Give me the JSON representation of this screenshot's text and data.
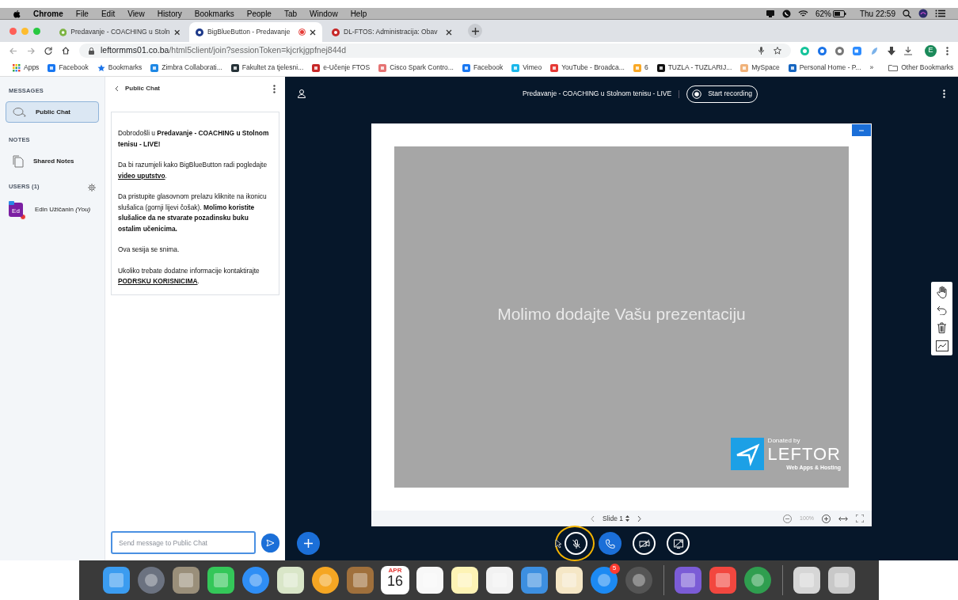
{
  "menubar": {
    "app": "Chrome",
    "menus": [
      "File",
      "Edit",
      "View",
      "History",
      "Bookmarks",
      "People",
      "Tab",
      "Window",
      "Help"
    ],
    "battery": "62%",
    "clock": "Thu 22:59"
  },
  "tabs": [
    {
      "title": "Predavanje - COACHING u Stoln",
      "selected": false,
      "recording": false,
      "color": "#7cb342"
    },
    {
      "title": "BigBlueButton - Predavanje",
      "selected": true,
      "recording": true,
      "color": "#1e3a8a"
    },
    {
      "title": "DL-FTOS: Administracija: Obav",
      "selected": false,
      "recording": false,
      "color": "#c62828"
    }
  ],
  "address": {
    "host": "leftormms01.co.ba",
    "path": "/html5client/join?sessionToken=kjcrkjgpfnej844d"
  },
  "profile": "E",
  "bookmarks": [
    {
      "label": "Apps",
      "kind": "grid"
    },
    {
      "label": "Facebook",
      "kind": "site",
      "color": "#1877f2"
    },
    {
      "label": "Bookmarks",
      "kind": "star",
      "color": "#1a73e8"
    },
    {
      "label": "Zimbra Collaborati...",
      "kind": "site",
      "color": "#1e88e5"
    },
    {
      "label": "Fakultet za tjelesni...",
      "kind": "site",
      "color": "#263238"
    },
    {
      "label": "e-Učenje FTOS",
      "kind": "site",
      "color": "#c62828"
    },
    {
      "label": "Cisco Spark Contro...",
      "kind": "site",
      "color": "#e57373"
    },
    {
      "label": "Facebook",
      "kind": "site",
      "color": "#1877f2"
    },
    {
      "label": "Vimeo",
      "kind": "site",
      "color": "#1ab7ea"
    },
    {
      "label": "YouTube - Broadca...",
      "kind": "site",
      "color": "#e53935"
    },
    {
      "label": "6",
      "kind": "site",
      "color": "#f9a825"
    },
    {
      "label": "TUZLA - TUZLARIJ...",
      "kind": "site",
      "color": "#111111"
    },
    {
      "label": "MySpace",
      "kind": "site",
      "color": "#f0b27a"
    },
    {
      "label": "Personal Home - P...",
      "kind": "site",
      "color": "#1565c0"
    }
  ],
  "bookmarks_more": "»",
  "other_bookmarks": "Other Bookmarks",
  "sidebar": {
    "messages_heading": "MESSAGES",
    "public_chat": {
      "label": "Public Chat",
      "selected": true
    },
    "notes_heading": "NOTES",
    "shared_notes": {
      "label": "Shared Notes",
      "selected": false
    },
    "users_heading": "USERS (1)",
    "users": [
      {
        "initials": "Ed",
        "name": "Edin Užičanin",
        "you": "(You)",
        "color": "#7b1fa2"
      }
    ]
  },
  "chat": {
    "title": "Public Chat",
    "welcome": [
      {
        "parts": [
          {
            "text": "Dobrodošli u **Predavanje - COACHING u Stolnom tenisu - LIVE!**",
            "link": false
          }
        ]
      },
      {
        "parts": [
          {
            "text": "Da bi razumjeli kako BigBlueButton radi pogledajte ",
            "link": false
          },
          {
            "text": "video uputstvo",
            "link": true
          },
          {
            "text": ".",
            "link": false
          }
        ]
      },
      {
        "parts": [
          {
            "text": "Da pristupite glasovnom prelazu kliknite na ikonicu slušalica (gornji lijevi čošak). **Molimo koristite slušalice da ne stvarate pozadinsku buku ostalim učenicima.**",
            "link": false
          }
        ]
      },
      {
        "parts": [
          {
            "text": "Ova sesija se snima.",
            "link": false
          }
        ]
      },
      {
        "parts": [
          {
            "text": "Ukoliko trebate dodatne informacije kontaktirajte ",
            "link": false
          },
          {
            "text": "PODRSKU KORISNICIMA",
            "link": true
          },
          {
            "text": ".",
            "link": false
          }
        ]
      }
    ],
    "placeholder": "Send message to Public Chat"
  },
  "meeting": {
    "title": "Predavanje - COACHING u Stolnom tenisu - LIVE",
    "record_button": "Start recording",
    "slide_message": "Molimo dodajte Vašu prezentaciju",
    "logo": {
      "top": "Donated by",
      "name": "LEFTOR",
      "tagline": "Web Apps & Hosting"
    },
    "slide_label": "Slide 1",
    "zoom": "100%",
    "actions": [
      {
        "kind": "mic",
        "active": false,
        "highlighted": true
      },
      {
        "kind": "phone",
        "active": true,
        "highlighted": false
      },
      {
        "kind": "video",
        "active": false,
        "highlighted": false
      },
      {
        "kind": "screen",
        "active": false,
        "highlighted": false
      }
    ]
  },
  "dock": [
    {
      "kind": "square",
      "color": "#3b9cf0"
    },
    {
      "kind": "circle",
      "color": "#6b7280"
    },
    {
      "kind": "square",
      "color": "#9a8f7a"
    },
    {
      "kind": "square",
      "color": "#34c759"
    },
    {
      "kind": "circle",
      "color": "#2f8ef5"
    },
    {
      "kind": "square",
      "color": "#d9e6c8"
    },
    {
      "kind": "circle",
      "color": "#f5a623"
    },
    {
      "kind": "square",
      "color": "#a0703c"
    },
    {
      "kind": "calendar",
      "color": "#ffffff",
      "month": "APR",
      "day": "16"
    },
    {
      "kind": "square",
      "color": "#f8f8f8"
    },
    {
      "kind": "square",
      "color": "#fdf3b5"
    },
    {
      "kind": "square",
      "color": "#f2f2f2"
    },
    {
      "kind": "square",
      "color": "#3d8fe0"
    },
    {
      "kind": "square",
      "color": "#f5e7c6"
    },
    {
      "kind": "circle",
      "color": "#1c8af3",
      "badge": "5"
    },
    {
      "kind": "circle",
      "color": "#555555"
    },
    {
      "kind": "separator"
    },
    {
      "kind": "square",
      "color": "#7b5cd6"
    },
    {
      "kind": "square",
      "color": "#f2473f"
    },
    {
      "kind": "circle",
      "color": "#2f9e4f"
    },
    {
      "kind": "separator"
    },
    {
      "kind": "square",
      "color": "#d6d6d6"
    },
    {
      "kind": "square",
      "color": "#c8c8c8"
    }
  ]
}
